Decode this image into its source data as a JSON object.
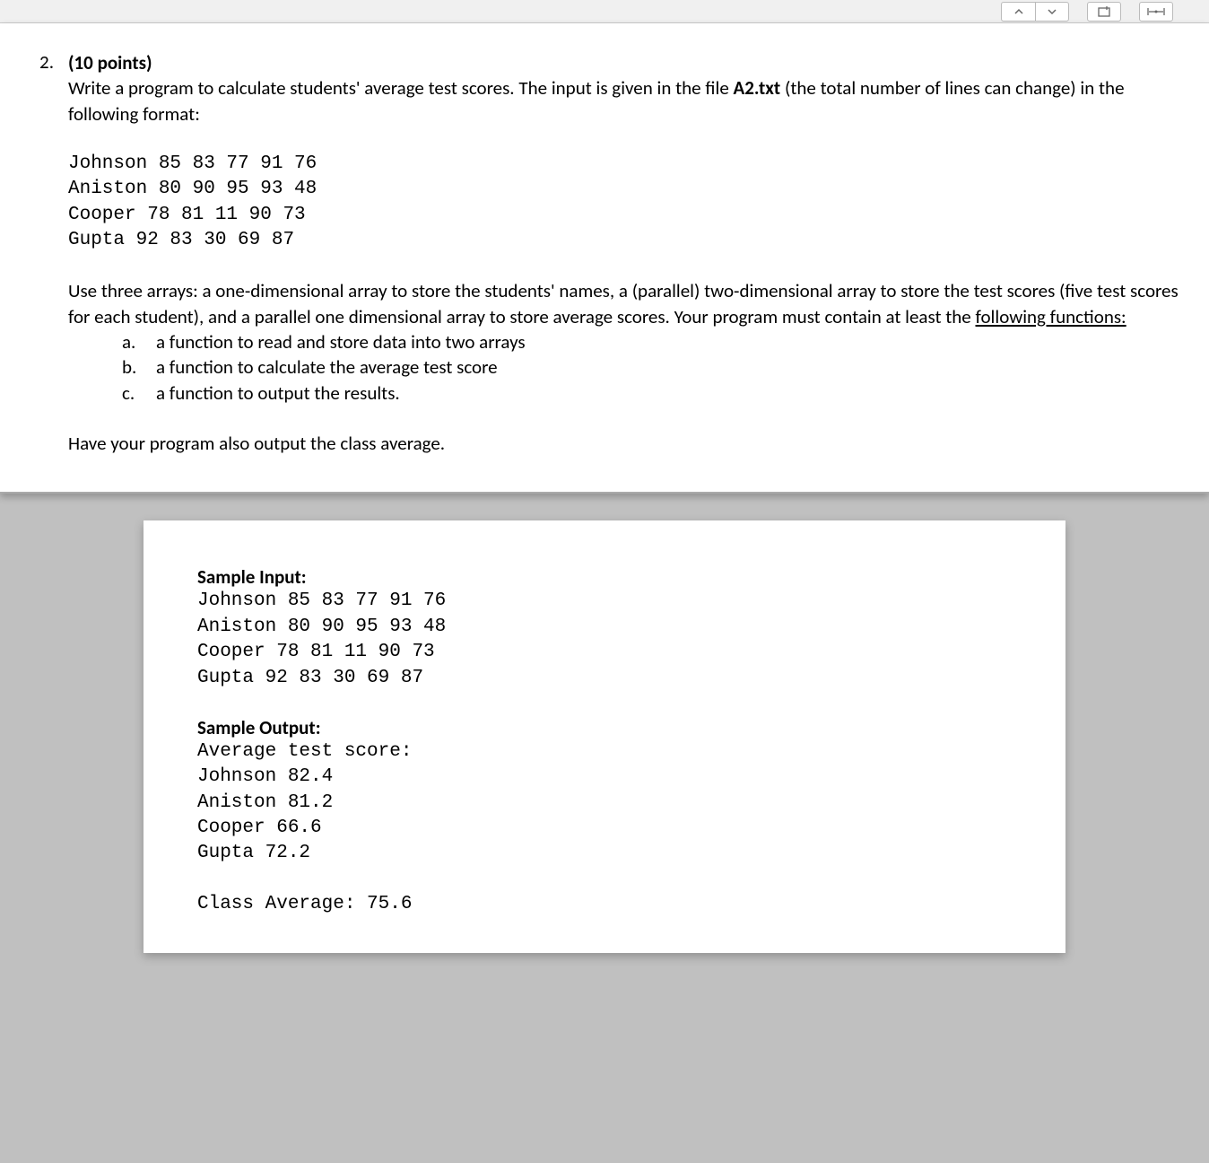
{
  "toolbar": {
    "up": "⌃",
    "down": "⌄"
  },
  "question": {
    "number": "2.",
    "points": "(10 points)",
    "intro_part1": "Write a program to calculate students' average test scores. The input is given in the file ",
    "filename": "A2.txt",
    "intro_part2": " (the total number of lines can change) in the following format:",
    "sample_data": "Johnson 85 83 77 91 76\nAniston 80 90 95 93 48\nCooper 78 81 11 90 73\nGupta 92 83 30 69 87",
    "body_part1": "Use three arrays: a one-dimensional array to store the students' names, a (parallel) two-dimensional array to store the test scores (five test scores for each student), and a parallel one dimensional array to store average scores. Your program must contain at least the ",
    "body_underline": "following functions:",
    "sub": {
      "a_label": "a.",
      "a_text": "a function to read and store data into two arrays",
      "b_label": "b.",
      "b_text": "a function to calculate the average test score",
      "c_label": "c.",
      "c_text": "a function to output the results."
    },
    "closing": "Have your program also output the class average."
  },
  "sample": {
    "input_title": "Sample Input:",
    "input_data": "Johnson 85 83 77 91 76\nAniston 80 90 95 93 48\nCooper 78 81 11 90 73\nGupta 92 83 30 69 87",
    "output_title": "Sample Output:",
    "output_data": "Average test score:\nJohnson 82.4\nAniston 81.2\nCooper 66.6\nGupta 72.2\n\nClass Average: 75.6"
  }
}
